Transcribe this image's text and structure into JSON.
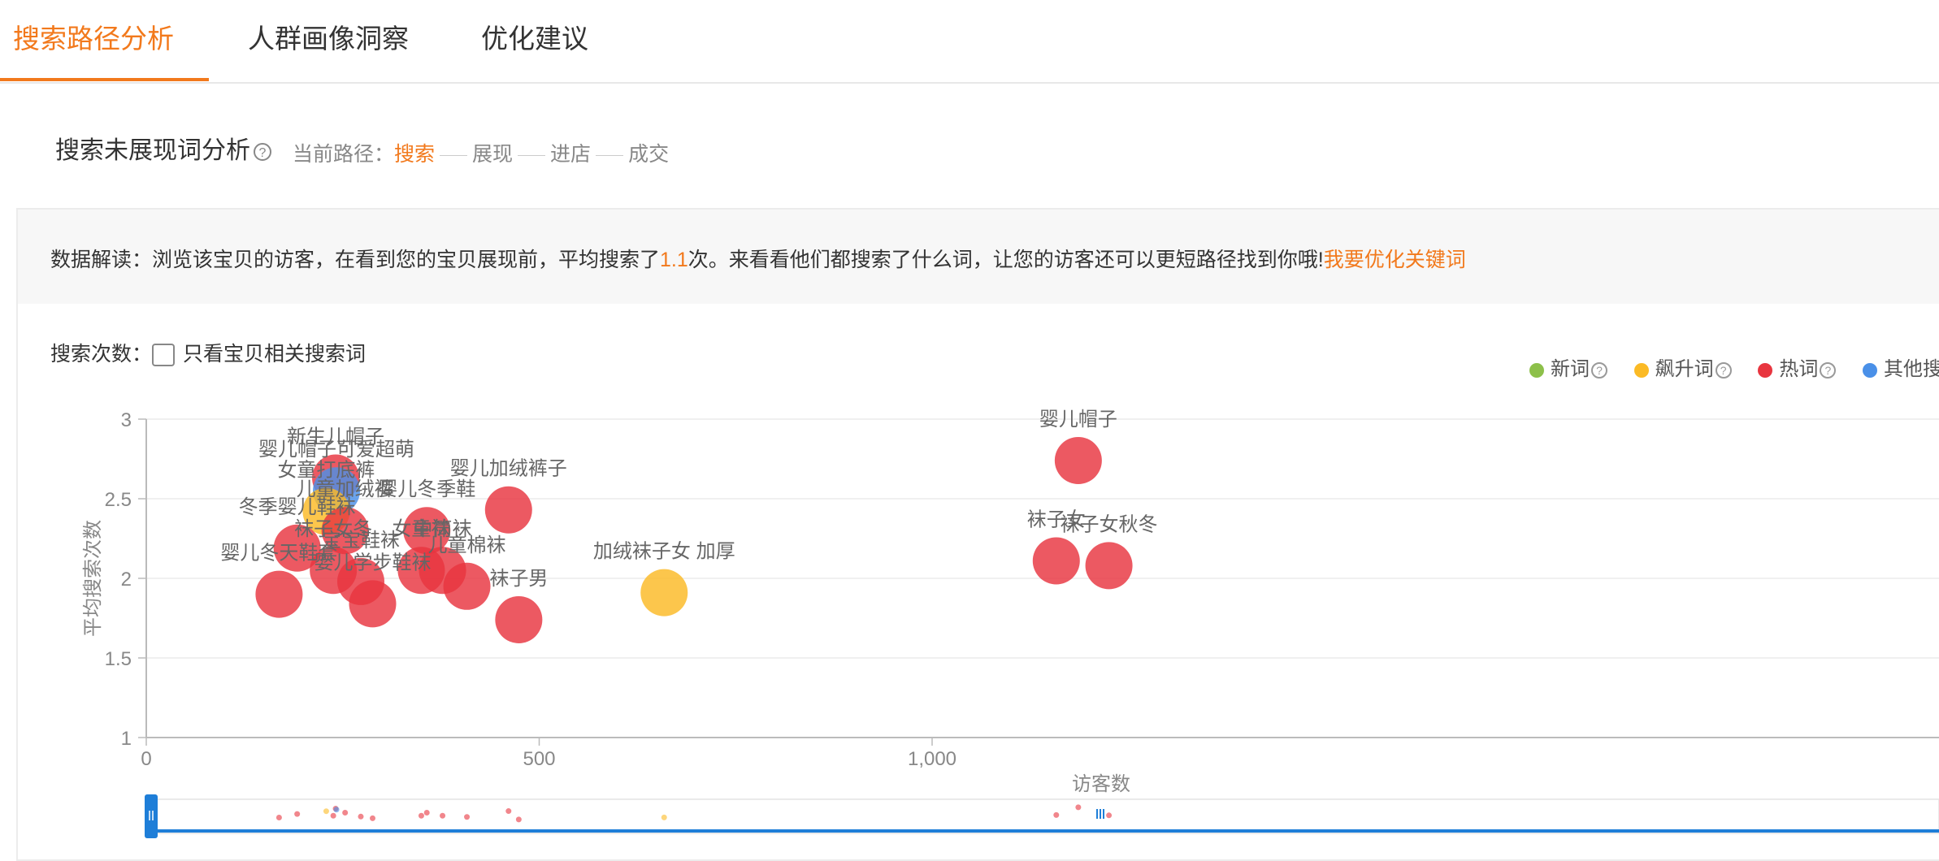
{
  "tabs": [
    {
      "label": "搜索路径分析",
      "active": true
    },
    {
      "label": "人群画像洞察",
      "active": false
    },
    {
      "label": "优化建议",
      "active": false
    }
  ],
  "section": {
    "title": "搜索未展现词分析",
    "path_label": "当前路径：",
    "path_steps": [
      "搜索",
      "展现",
      "进店",
      "成交"
    ]
  },
  "insight": {
    "prefix": "数据解读：浏览该宝贝的访客，在看到您的宝贝展现前，平均搜索了",
    "value": "1.1",
    "suffix": "次。来看看他们都搜索了什么词，让您的访客还可以更短路径找到你哦!",
    "link": "我要优化关键词"
  },
  "filter": {
    "label": "搜索次数：",
    "checkbox_label": "只看宝贝相关搜索词"
  },
  "colors": {
    "accent": "#f2791c",
    "new": "#8dc04a",
    "rising": "#fbba25",
    "hot": "#e8353f",
    "other": "#4a90e8"
  },
  "legend": [
    {
      "label": "新词",
      "color": "#8dc04a"
    },
    {
      "label": "飙升词",
      "color": "#fbba25"
    },
    {
      "label": "热词",
      "color": "#e8353f"
    },
    {
      "label": "其他搜",
      "color": "#4a90e8"
    }
  ],
  "chart_data": {
    "type": "scatter",
    "xlabel": "访客数",
    "ylabel": "平均搜索次数",
    "xlim": [
      0,
      1400
    ],
    "ylim": [
      1,
      3
    ],
    "x_ticks": [
      0,
      500,
      1000
    ],
    "x_tick_labels": [
      "0",
      "500",
      "1,000"
    ],
    "y_ticks": [
      1,
      1.5,
      2,
      2.5,
      3
    ],
    "y_tick_labels": [
      "1",
      "1.5",
      "2",
      "2.5",
      "3"
    ],
    "grid": true,
    "legend_position": "top-right",
    "points": [
      {
        "label": "婴儿帽子",
        "x": 1186,
        "y": 2.74,
        "category": "hot"
      },
      {
        "label": "袜子女",
        "x": 1158,
        "y": 2.11,
        "category": "hot"
      },
      {
        "label": "袜子女秋冬",
        "x": 1225,
        "y": 2.08,
        "category": "hot"
      },
      {
        "label": "加绒袜子女 加厚",
        "x": 659,
        "y": 1.91,
        "category": "rising"
      },
      {
        "label": "婴儿加绒裤子",
        "x": 461,
        "y": 2.43,
        "category": "hot"
      },
      {
        "label": "袜子男",
        "x": 474,
        "y": 1.74,
        "category": "hot"
      },
      {
        "label": "婴儿冬季鞋",
        "x": 357,
        "y": 2.3,
        "category": "hot"
      },
      {
        "label": "女童袜",
        "x": 350,
        "y": 2.05,
        "category": "hot"
      },
      {
        "label": "中筒袜",
        "x": 377,
        "y": 2.05,
        "category": "hot"
      },
      {
        "label": "儿童棉袜",
        "x": 408,
        "y": 1.95,
        "category": "hot"
      },
      {
        "label": "新生儿帽子",
        "x": 241,
        "y": 2.63,
        "category": "hot"
      },
      {
        "label": "婴儿帽子可爱超萌",
        "x": 242,
        "y": 2.55,
        "category": "other"
      },
      {
        "label": "女童打底裤",
        "x": 229,
        "y": 2.42,
        "category": "rising"
      },
      {
        "label": "儿童加绒裤",
        "x": 253,
        "y": 2.3,
        "category": "hot"
      },
      {
        "label": "冬季婴儿鞋袜",
        "x": 192,
        "y": 2.19,
        "category": "hot"
      },
      {
        "label": "袜子女冬",
        "x": 238,
        "y": 2.05,
        "category": "hot"
      },
      {
        "label": "婴儿冬天鞋套",
        "x": 169,
        "y": 1.9,
        "category": "hot"
      },
      {
        "label": "宝宝鞋袜",
        "x": 273,
        "y": 1.98,
        "category": "hot"
      },
      {
        "label": "婴儿学步鞋袜",
        "x": 288,
        "y": 1.84,
        "category": "hot"
      }
    ]
  }
}
